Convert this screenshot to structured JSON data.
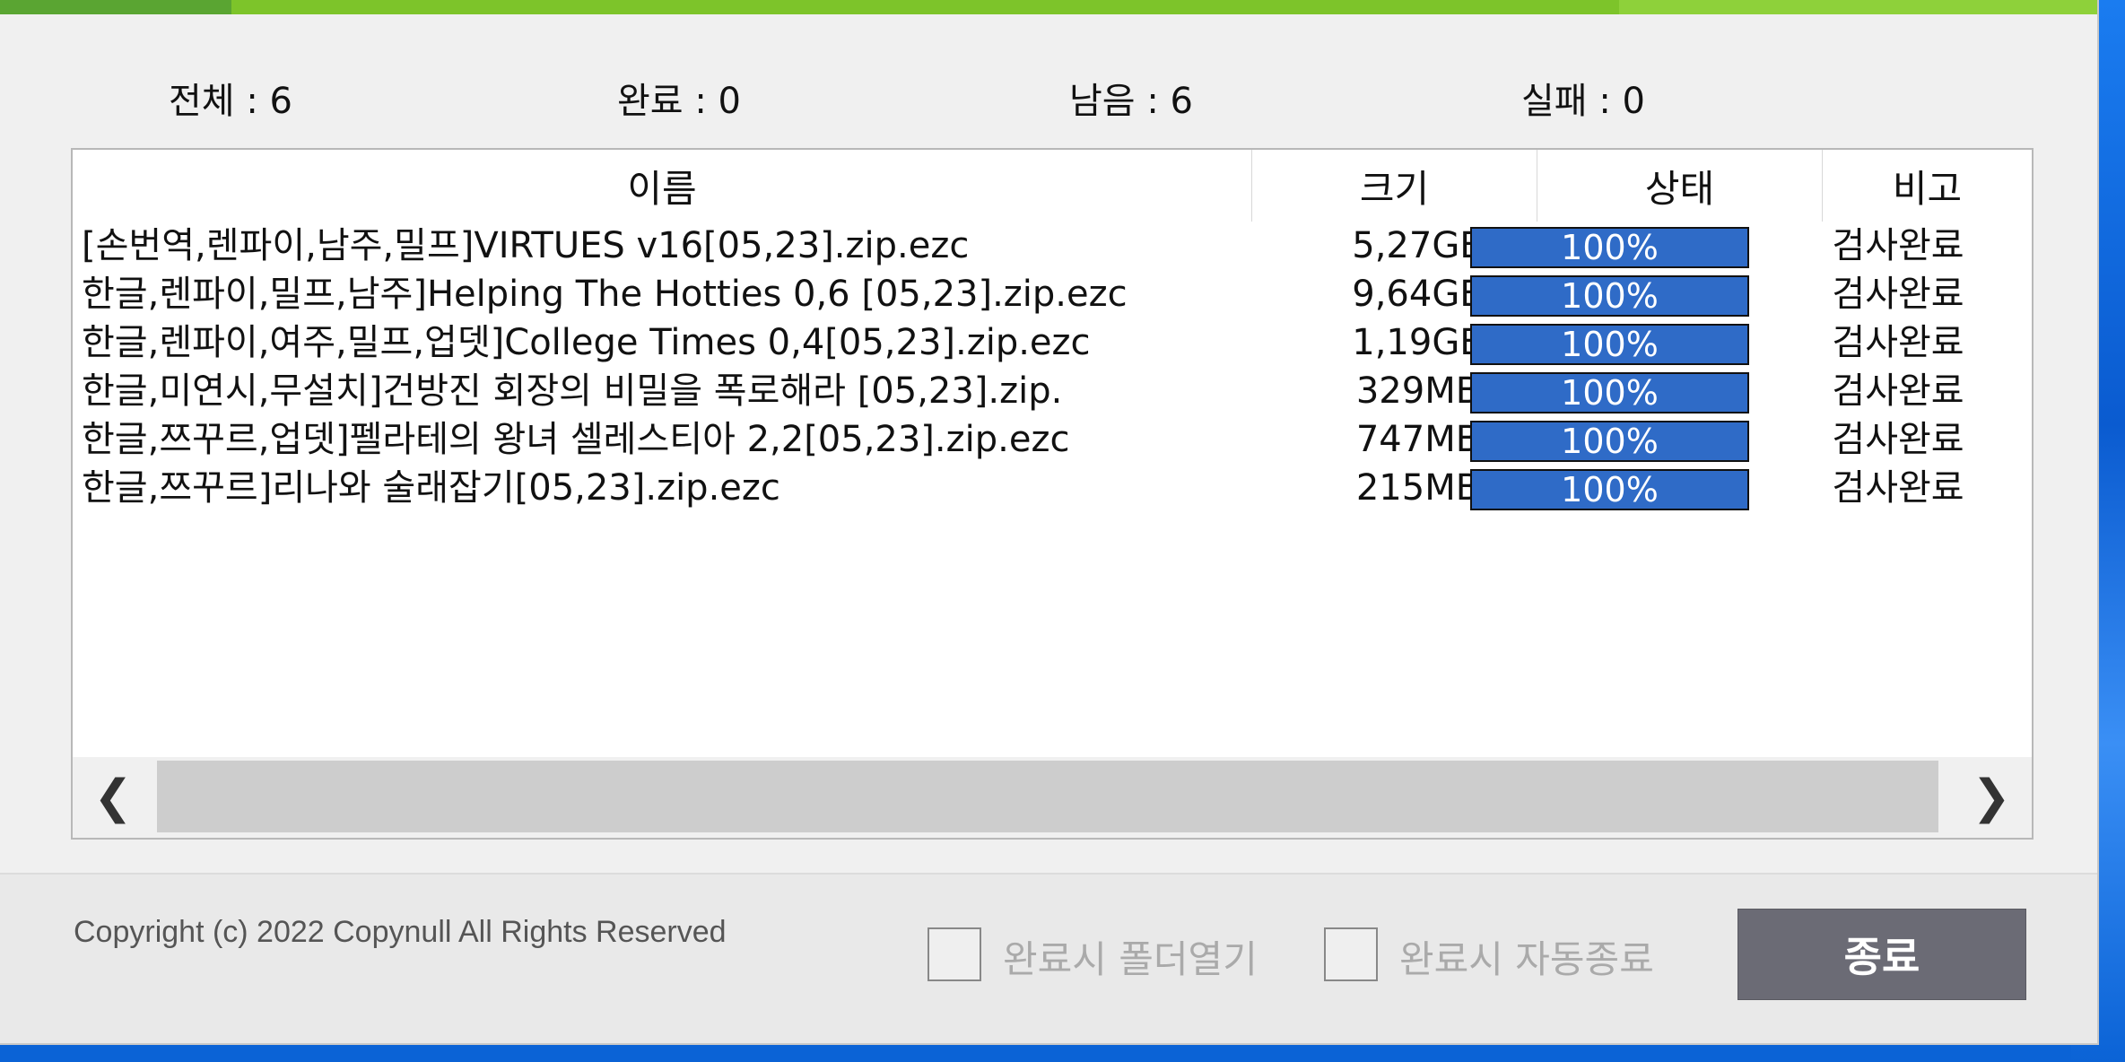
{
  "stats": {
    "total": "전체 : 6",
    "done": "완료 : 0",
    "remaining": "남음 : 6",
    "failed": "실패 : 0"
  },
  "columns": {
    "name": "이름",
    "size": "크기",
    "status": "상태",
    "note": "비고"
  },
  "files": [
    {
      "name": "[손번역,렌파이,남주,밀프]VIRTUES v16[05,23].zip.ezc",
      "size": "5,27GB",
      "progress": "100%",
      "note": "검사완료"
    },
    {
      "name": "한글,렌파이,밀프,남주]Helping The Hotties 0,6 [05,23].zip.ezc",
      "size": "9,64GB",
      "progress": "100%",
      "note": "검사완료"
    },
    {
      "name": "한글,렌파이,여주,밀프,업뎃]College Times 0,4[05,23].zip.ezc",
      "size": "1,19GB",
      "progress": "100%",
      "note": "검사완료"
    },
    {
      "name": "한글,미연시,무설치]건방진 회장의 비밀을 폭로해라 [05,23].zip.",
      "size": "329MB",
      "progress": "100%",
      "note": "검사완료"
    },
    {
      "name": "한글,쯔꾸르,업뎃]펠라테의 왕녀 셀레스티아 2,2[05,23].zip.ezc",
      "size": "747MB",
      "progress": "100%",
      "note": "검사완료"
    },
    {
      "name": "한글,쯔꾸르]리나와 술래잡기[05,23].zip.ezc",
      "size": "215MB",
      "progress": "100%",
      "note": "검사완료"
    }
  ],
  "footer": {
    "copyright": "Copyright (c) 2022 Copynull All Rights Reserved",
    "open_folder_label": "완료시 폴더열기",
    "auto_exit_label": "완료시 자동종료",
    "close_button": "종료"
  },
  "icons": {
    "scroll_left": "chevron-left-icon",
    "scroll_right": "chevron-right-icon"
  },
  "colors": {
    "progress_fill": "#2f6bc7",
    "top_strip": "#7dc42a",
    "close_button": "#6b6b75"
  }
}
